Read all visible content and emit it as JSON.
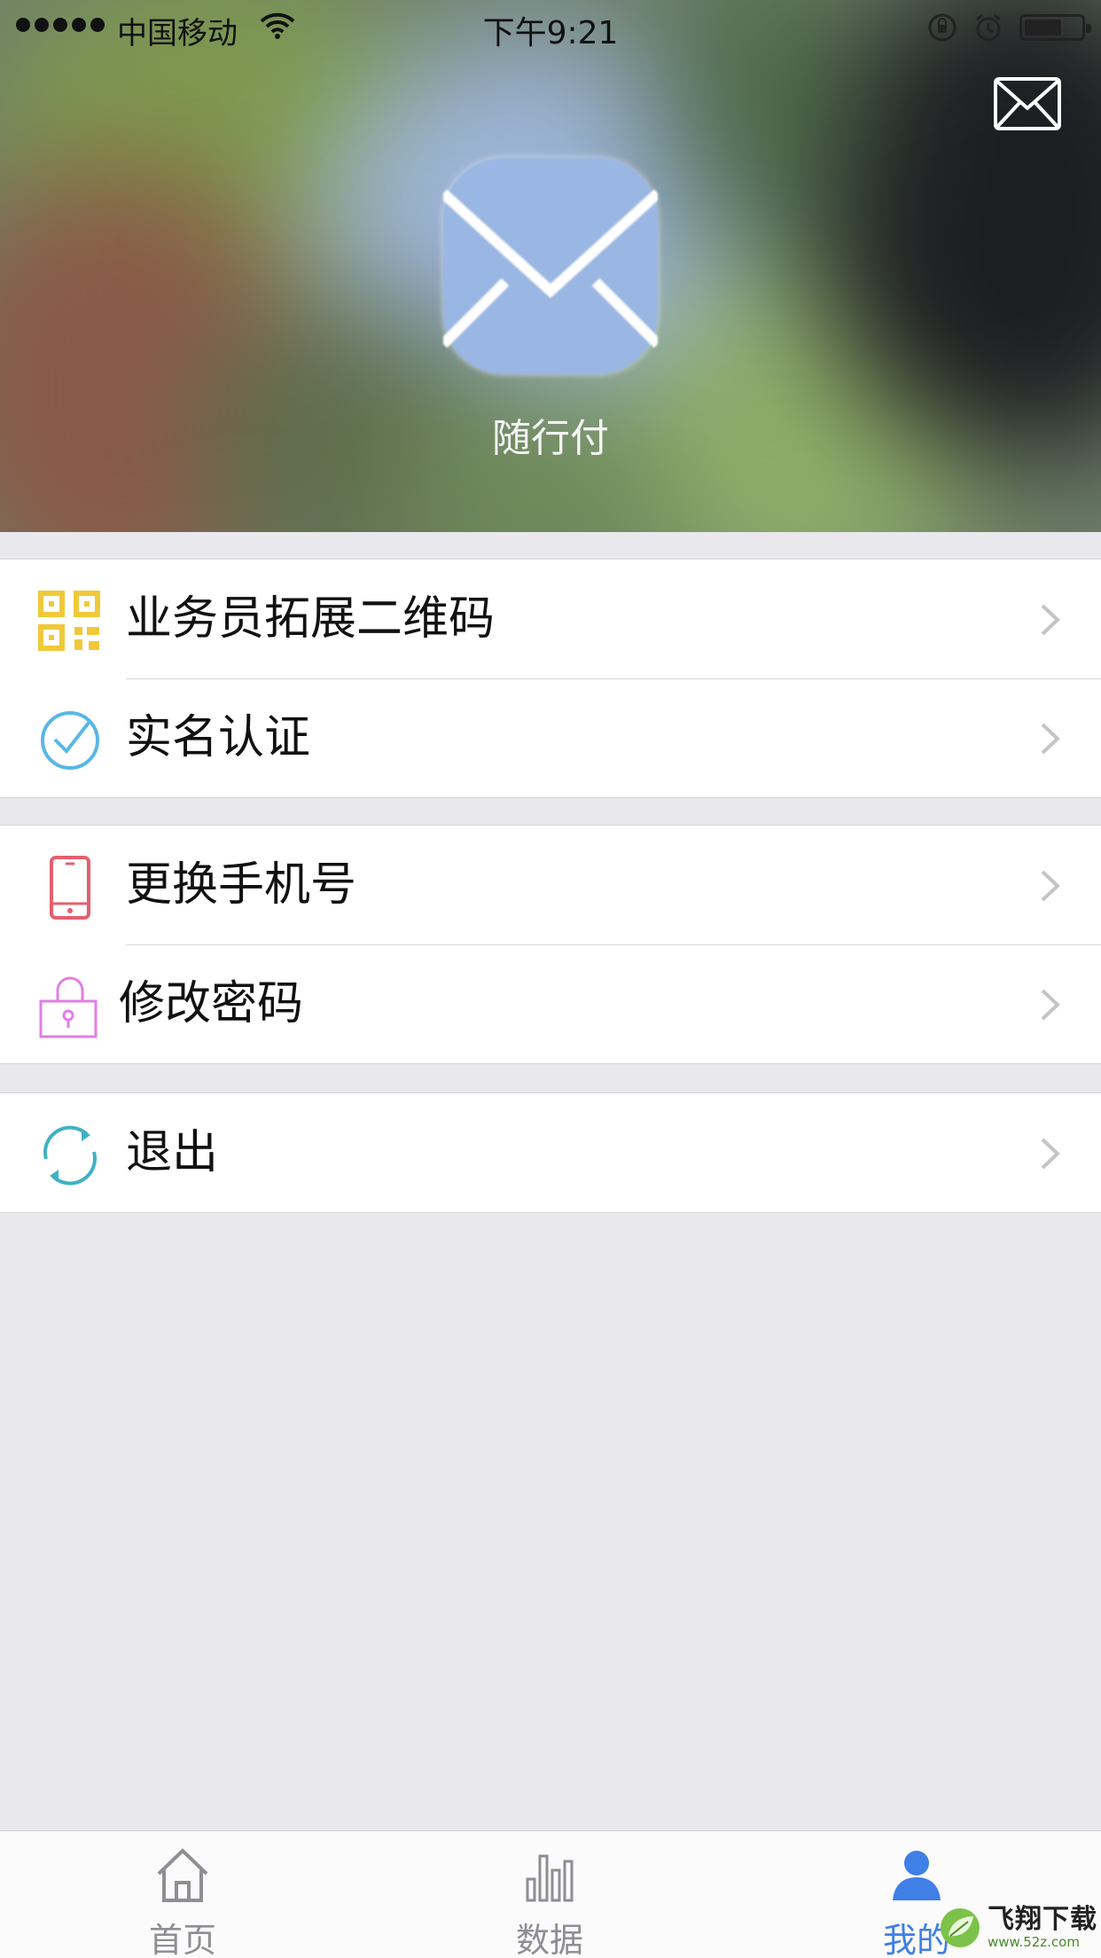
{
  "status_bar": {
    "carrier": "中国移动",
    "time": "下午9:21"
  },
  "header": {
    "app_name": "随行付",
    "message_icon": "envelope-icon"
  },
  "menu_groups": [
    {
      "items": [
        {
          "label": "业务员拓展二维码",
          "icon": "qr-code-icon",
          "color": "#f0c93a"
        },
        {
          "label": "实名认证",
          "icon": "check-circle-icon",
          "color": "#58b7e6"
        }
      ]
    },
    {
      "items": [
        {
          "label": "更换手机号",
          "icon": "phone-icon",
          "color": "#e4606e"
        },
        {
          "label": "修改密码",
          "icon": "lock-icon",
          "color": "#e27ee6"
        }
      ]
    },
    {
      "items": [
        {
          "label": "退出",
          "icon": "refresh-icon",
          "color": "#3fb1c4"
        }
      ]
    }
  ],
  "tabbar": {
    "tabs": [
      {
        "label": "首页",
        "icon": "home-icon",
        "active": false
      },
      {
        "label": "数据",
        "icon": "bar-chart-icon",
        "active": false
      },
      {
        "label": "我的",
        "icon": "user-icon",
        "active": true
      }
    ],
    "active_color": "#3f7fe6",
    "inactive_color": "#8e8e93"
  },
  "watermark": {
    "name": "飞翔下载",
    "url": "www.52z.com"
  }
}
